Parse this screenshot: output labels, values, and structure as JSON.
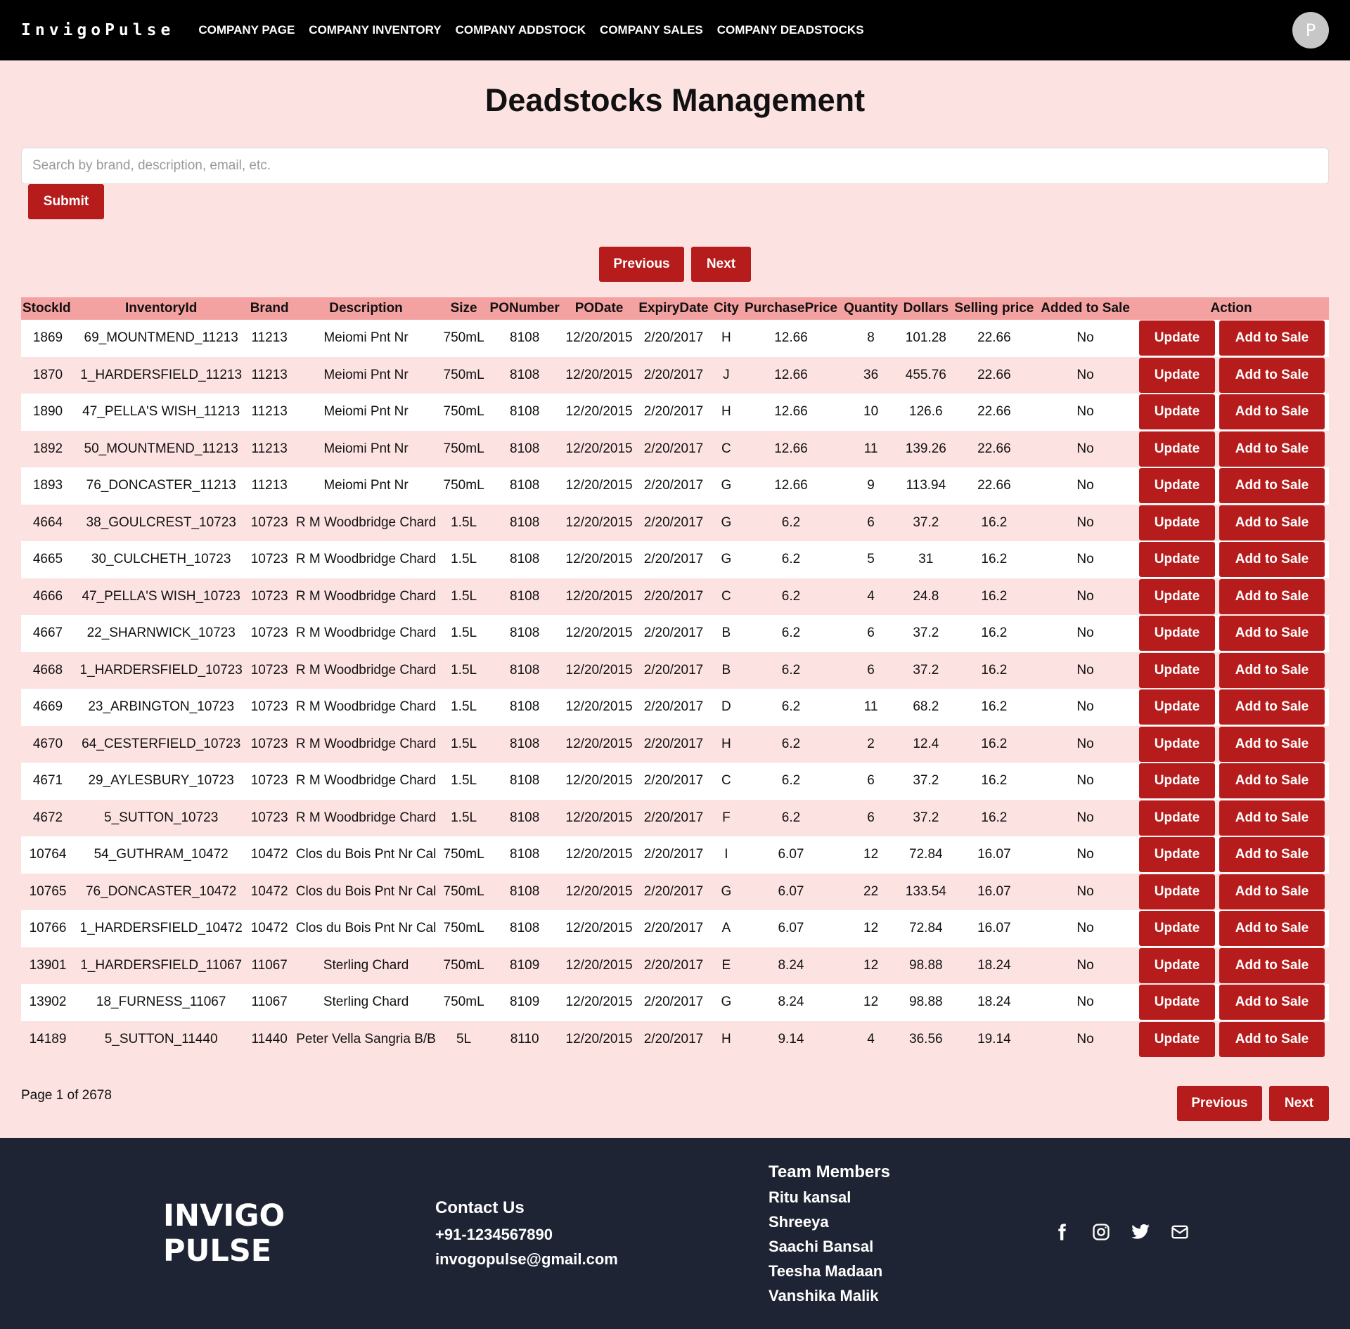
{
  "nav": {
    "brand": "InvigoPulse",
    "links": [
      "COMPANY PAGE",
      "COMPANY INVENTORY",
      "COMPANY ADDSTOCK",
      "COMPANY SALES",
      "COMPANY DEADSTOCKS"
    ],
    "avatar_initial": "P"
  },
  "page": {
    "title": "Deadstocks Management",
    "search_placeholder": "Search by brand, description, email, etc.",
    "submit_label": "Submit",
    "previous_label": "Previous",
    "next_label": "Next",
    "page_info": "Page 1 of 2678"
  },
  "table": {
    "columns": [
      "StockId",
      "InventoryId",
      "Brand",
      "Description",
      "Size",
      "PONumber",
      "PODate",
      "ExpiryDate",
      "City",
      "PurchasePrice",
      "Quantity",
      "Dollars",
      "Selling price",
      "Added to Sale",
      "Action"
    ],
    "update_label": "Update",
    "add_to_sale_label": "Add to Sale",
    "rows": [
      [
        "1869",
        "69_MOUNTMEND_11213",
        "11213",
        "Meiomi Pnt Nr",
        "750mL",
        "8108",
        "12/20/2015",
        "2/20/2017",
        "H",
        "12.66",
        "8",
        "101.28",
        "22.66",
        "No"
      ],
      [
        "1870",
        "1_HARDERSFIELD_11213",
        "11213",
        "Meiomi Pnt Nr",
        "750mL",
        "8108",
        "12/20/2015",
        "2/20/2017",
        "J",
        "12.66",
        "36",
        "455.76",
        "22.66",
        "No"
      ],
      [
        "1890",
        "47_PELLA'S WISH_11213",
        "11213",
        "Meiomi Pnt Nr",
        "750mL",
        "8108",
        "12/20/2015",
        "2/20/2017",
        "H",
        "12.66",
        "10",
        "126.6",
        "22.66",
        "No"
      ],
      [
        "1892",
        "50_MOUNTMEND_11213",
        "11213",
        "Meiomi Pnt Nr",
        "750mL",
        "8108",
        "12/20/2015",
        "2/20/2017",
        "C",
        "12.66",
        "11",
        "139.26",
        "22.66",
        "No"
      ],
      [
        "1893",
        "76_DONCASTER_11213",
        "11213",
        "Meiomi Pnt Nr",
        "750mL",
        "8108",
        "12/20/2015",
        "2/20/2017",
        "G",
        "12.66",
        "9",
        "113.94",
        "22.66",
        "No"
      ],
      [
        "4664",
        "38_GOULCREST_10723",
        "10723",
        "R M Woodbridge Chard",
        "1.5L",
        "8108",
        "12/20/2015",
        "2/20/2017",
        "G",
        "6.2",
        "6",
        "37.2",
        "16.2",
        "No"
      ],
      [
        "4665",
        "30_CULCHETH_10723",
        "10723",
        "R M Woodbridge Chard",
        "1.5L",
        "8108",
        "12/20/2015",
        "2/20/2017",
        "G",
        "6.2",
        "5",
        "31",
        "16.2",
        "No"
      ],
      [
        "4666",
        "47_PELLA'S WISH_10723",
        "10723",
        "R M Woodbridge Chard",
        "1.5L",
        "8108",
        "12/20/2015",
        "2/20/2017",
        "C",
        "6.2",
        "4",
        "24.8",
        "16.2",
        "No"
      ],
      [
        "4667",
        "22_SHARNWICK_10723",
        "10723",
        "R M Woodbridge Chard",
        "1.5L",
        "8108",
        "12/20/2015",
        "2/20/2017",
        "B",
        "6.2",
        "6",
        "37.2",
        "16.2",
        "No"
      ],
      [
        "4668",
        "1_HARDERSFIELD_10723",
        "10723",
        "R M Woodbridge Chard",
        "1.5L",
        "8108",
        "12/20/2015",
        "2/20/2017",
        "B",
        "6.2",
        "6",
        "37.2",
        "16.2",
        "No"
      ],
      [
        "4669",
        "23_ARBINGTON_10723",
        "10723",
        "R M Woodbridge Chard",
        "1.5L",
        "8108",
        "12/20/2015",
        "2/20/2017",
        "D",
        "6.2",
        "11",
        "68.2",
        "16.2",
        "No"
      ],
      [
        "4670",
        "64_CESTERFIELD_10723",
        "10723",
        "R M Woodbridge Chard",
        "1.5L",
        "8108",
        "12/20/2015",
        "2/20/2017",
        "H",
        "6.2",
        "2",
        "12.4",
        "16.2",
        "No"
      ],
      [
        "4671",
        "29_AYLESBURY_10723",
        "10723",
        "R M Woodbridge Chard",
        "1.5L",
        "8108",
        "12/20/2015",
        "2/20/2017",
        "C",
        "6.2",
        "6",
        "37.2",
        "16.2",
        "No"
      ],
      [
        "4672",
        "5_SUTTON_10723",
        "10723",
        "R M Woodbridge Chard",
        "1.5L",
        "8108",
        "12/20/2015",
        "2/20/2017",
        "F",
        "6.2",
        "6",
        "37.2",
        "16.2",
        "No"
      ],
      [
        "10764",
        "54_GUTHRAM_10472",
        "10472",
        "Clos du Bois Pnt Nr Cal",
        "750mL",
        "8108",
        "12/20/2015",
        "2/20/2017",
        "I",
        "6.07",
        "12",
        "72.84",
        "16.07",
        "No"
      ],
      [
        "10765",
        "76_DONCASTER_10472",
        "10472",
        "Clos du Bois Pnt Nr Cal",
        "750mL",
        "8108",
        "12/20/2015",
        "2/20/2017",
        "G",
        "6.07",
        "22",
        "133.54",
        "16.07",
        "No"
      ],
      [
        "10766",
        "1_HARDERSFIELD_10472",
        "10472",
        "Clos du Bois Pnt Nr Cal",
        "750mL",
        "8108",
        "12/20/2015",
        "2/20/2017",
        "A",
        "6.07",
        "12",
        "72.84",
        "16.07",
        "No"
      ],
      [
        "13901",
        "1_HARDERSFIELD_11067",
        "11067",
        "Sterling Chard",
        "750mL",
        "8109",
        "12/20/2015",
        "2/20/2017",
        "E",
        "8.24",
        "12",
        "98.88",
        "18.24",
        "No"
      ],
      [
        "13902",
        "18_FURNESS_11067",
        "11067",
        "Sterling Chard",
        "750mL",
        "8109",
        "12/20/2015",
        "2/20/2017",
        "G",
        "8.24",
        "12",
        "98.88",
        "18.24",
        "No"
      ],
      [
        "14189",
        "5_SUTTON_11440",
        "11440",
        "Peter Vella Sangria B/B",
        "5L",
        "8110",
        "12/20/2015",
        "2/20/2017",
        "H",
        "9.14",
        "4",
        "36.56",
        "19.14",
        "No"
      ]
    ]
  },
  "footer": {
    "logo_line1": "INVIGO",
    "logo_line2": "PULSE",
    "contact_title": "Contact Us",
    "phone": "+91-1234567890",
    "email": "invogopulse@gmail.com",
    "team_title": "Team Members",
    "team": [
      "Ritu kansal",
      "Shreeya",
      "Saachi Bansal",
      "Teesha Madaan",
      "Vanshika Malik"
    ],
    "socials": [
      "facebook-icon",
      "instagram-icon",
      "twitter-icon",
      "mail-icon"
    ]
  },
  "colors": {
    "accent": "#b71c1c",
    "page_bg": "#fde2e2",
    "header_row": "#f4a1a1",
    "footer_bg": "#1e2433",
    "navbar_bg": "#000000"
  }
}
